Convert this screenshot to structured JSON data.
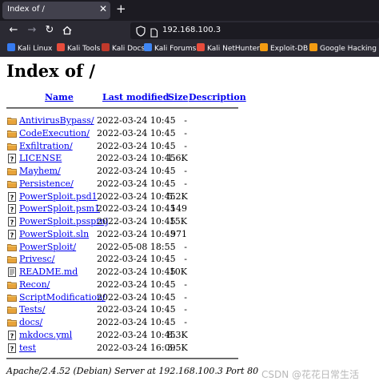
{
  "browser": {
    "tab_title": "Index of /",
    "tab_close": "✕",
    "new_tab": "+",
    "url": "192.168.100.3",
    "bookmarks": [
      {
        "label": "Kali Linux",
        "color": "#367bf0"
      },
      {
        "label": "Kali Tools",
        "color": "#e74c3c"
      },
      {
        "label": "Kali Docs",
        "color": "#c0392b"
      },
      {
        "label": "Kali Forums",
        "color": "#3f86f4"
      },
      {
        "label": "Kali NetHunter",
        "color": "#e74c3c"
      },
      {
        "label": "Exploit-DB",
        "color": "#f39c12"
      },
      {
        "label": "Google Hacking DB",
        "color": "#f39c12"
      }
    ]
  },
  "page": {
    "heading": "Index of /",
    "columns": {
      "name": "Name",
      "last_modified": "Last modified",
      "size": "Size",
      "description": "Description"
    },
    "entries": [
      {
        "name": "AntivirusBypass/",
        "date": "2022-03-24 10:45",
        "size": "-",
        "type": "folder"
      },
      {
        "name": "CodeExecution/",
        "date": "2022-03-24 10:45",
        "size": "-",
        "type": "folder"
      },
      {
        "name": "Exfiltration/",
        "date": "2022-03-24 10:45",
        "size": "-",
        "type": "folder"
      },
      {
        "name": "LICENSE",
        "date": "2022-03-24 10:45",
        "size": "1.6K",
        "type": "unknown"
      },
      {
        "name": "Mayhem/",
        "date": "2022-03-24 10:45",
        "size": "-",
        "type": "folder"
      },
      {
        "name": "Persistence/",
        "date": "2022-03-24 10:45",
        "size": "-",
        "type": "folder"
      },
      {
        "name": "PowerSploit.psd1",
        "date": "2022-03-24 10:45",
        "size": "5.2K",
        "type": "unknown"
      },
      {
        "name": "PowerSploit.psm1",
        "date": "2022-03-24 10:45",
        "size": "149",
        "type": "unknown"
      },
      {
        "name": "PowerSploit.pssproj",
        "date": "2022-03-24 10:45",
        "size": "15K",
        "type": "unknown"
      },
      {
        "name": "PowerSploit.sln",
        "date": "2022-03-24 10:45",
        "size": "971",
        "type": "unknown"
      },
      {
        "name": "PowerSploit/",
        "date": "2022-05-08 18:55",
        "size": "-",
        "type": "folder"
      },
      {
        "name": "Privesc/",
        "date": "2022-03-24 10:45",
        "size": "-",
        "type": "folder"
      },
      {
        "name": "README.md",
        "date": "2022-03-24 10:45",
        "size": "10K",
        "type": "text"
      },
      {
        "name": "Recon/",
        "date": "2022-03-24 10:45",
        "size": "-",
        "type": "folder"
      },
      {
        "name": "ScriptModification/",
        "date": "2022-03-24 10:45",
        "size": "-",
        "type": "folder"
      },
      {
        "name": "Tests/",
        "date": "2022-03-24 10:45",
        "size": "-",
        "type": "folder"
      },
      {
        "name": "docs/",
        "date": "2022-03-24 10:45",
        "size": "-",
        "type": "folder"
      },
      {
        "name": "mkdocs.yml",
        "date": "2022-03-24 10:45",
        "size": "8.3K",
        "type": "unknown"
      },
      {
        "name": "test",
        "date": "2022-03-24 16:09",
        "size": "3.5K",
        "type": "unknown"
      }
    ],
    "footer": "Apache/2.4.52 (Debian) Server at 192.168.100.3 Port 80",
    "watermark": "CSDN @花花日常生活"
  }
}
